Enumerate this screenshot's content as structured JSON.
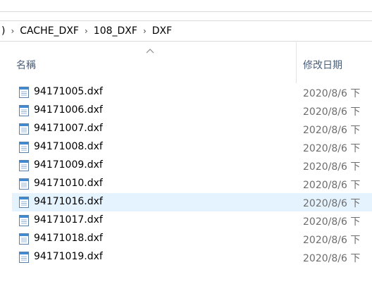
{
  "breadcrumb": {
    "lead": ")",
    "items": [
      "CACHE_DXF",
      "108_DXF",
      "DXF"
    ],
    "separator": "›"
  },
  "columns": {
    "name": "名稱",
    "date": "修改日期"
  },
  "files": [
    {
      "name": "94171005.dxf",
      "date": "2020/8/6 下"
    },
    {
      "name": "94171006.dxf",
      "date": "2020/8/6 下"
    },
    {
      "name": "94171007.dxf",
      "date": "2020/8/6 下"
    },
    {
      "name": "94171008.dxf",
      "date": "2020/8/6 下"
    },
    {
      "name": "94171009.dxf",
      "date": "2020/8/6 下"
    },
    {
      "name": "94171010.dxf",
      "date": "2020/8/6 下"
    },
    {
      "name": "94171016.dxf",
      "date": "2020/8/6 下",
      "selected": true
    },
    {
      "name": "94171017.dxf",
      "date": "2020/8/6 下"
    },
    {
      "name": "94171018.dxf",
      "date": "2020/8/6 下"
    },
    {
      "name": "94171019.dxf",
      "date": "2020/8/6 下"
    }
  ],
  "colors": {
    "header_text": "#4c607a",
    "hover_row": "#e5f3ff",
    "date_text": "#6d6d6d"
  },
  "icons": {
    "file": "text-document-icon",
    "sort": "sort-ascending-icon"
  }
}
